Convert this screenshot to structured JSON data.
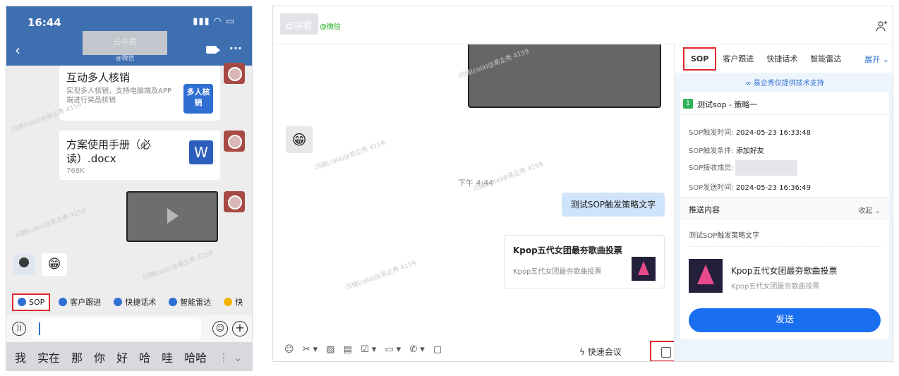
{
  "phone": {
    "time": "16:44",
    "status_icons": "信号 Wi-Fi 电量",
    "contact_name": "云中君",
    "contact_sub": "@微信",
    "card1": {
      "title": "互动多人核销",
      "desc": "实现多人核销，支持电脑端及APP端进行奖品核销",
      "thumb": "多人核销"
    },
    "card2": {
      "title": "方案使用手册（必读）.docx",
      "size": "768K",
      "badge": "W"
    },
    "toolbar": [
      {
        "label": "SOP"
      },
      {
        "label": "客户跟进"
      },
      {
        "label": "快捷话术"
      },
      {
        "label": "智能雷达"
      },
      {
        "label": "快"
      }
    ],
    "ime_keys": [
      "我",
      "实在",
      "那",
      "你",
      "好",
      "哈",
      "哇",
      "哈哈"
    ],
    "watermark": "闫婧(cola)@易企秀 4159"
  },
  "desktop": {
    "contact_name": "云中君",
    "contact_sub": "@微信",
    "time_label": "下午 4:44",
    "message": "测试SOP触发策略文字",
    "link_card": {
      "title": "Kpop五代女团最夯歌曲投票",
      "desc": "Kpop五代女团最夯歌曲投票"
    },
    "toolbar_icons": "☺ ✂▾ ▨ ▤ ☑▾ ▭▾ ✆▾ ▢",
    "quick_meeting": "快速会议",
    "tabs": [
      "SOP",
      "客户跟进",
      "快捷话术",
      "智能雷达"
    ],
    "expand": "展开",
    "support": "易企秀仅提供技术支持",
    "sop": {
      "num": "1",
      "name": "测试sop - 策略一",
      "trigger_time_label": "SOP触发时间:",
      "trigger_time": "2024-05-23 16:33:48",
      "trigger_cond_label": "SOP触发条件:",
      "trigger_cond": "添加好友",
      "receiver_label": "SOP接收成员:",
      "send_time_label": "SOP发送时间:",
      "send_time": "2024-05-23 16:36:49",
      "push_label": "推送内容",
      "collapse": "收起",
      "push_text": "测试SOP触发策略文字",
      "push_title": "Kpop五代女团最夯歌曲投票",
      "push_desc": "Kpop五代女团最夯歌曲投票",
      "send": "发送"
    }
  }
}
